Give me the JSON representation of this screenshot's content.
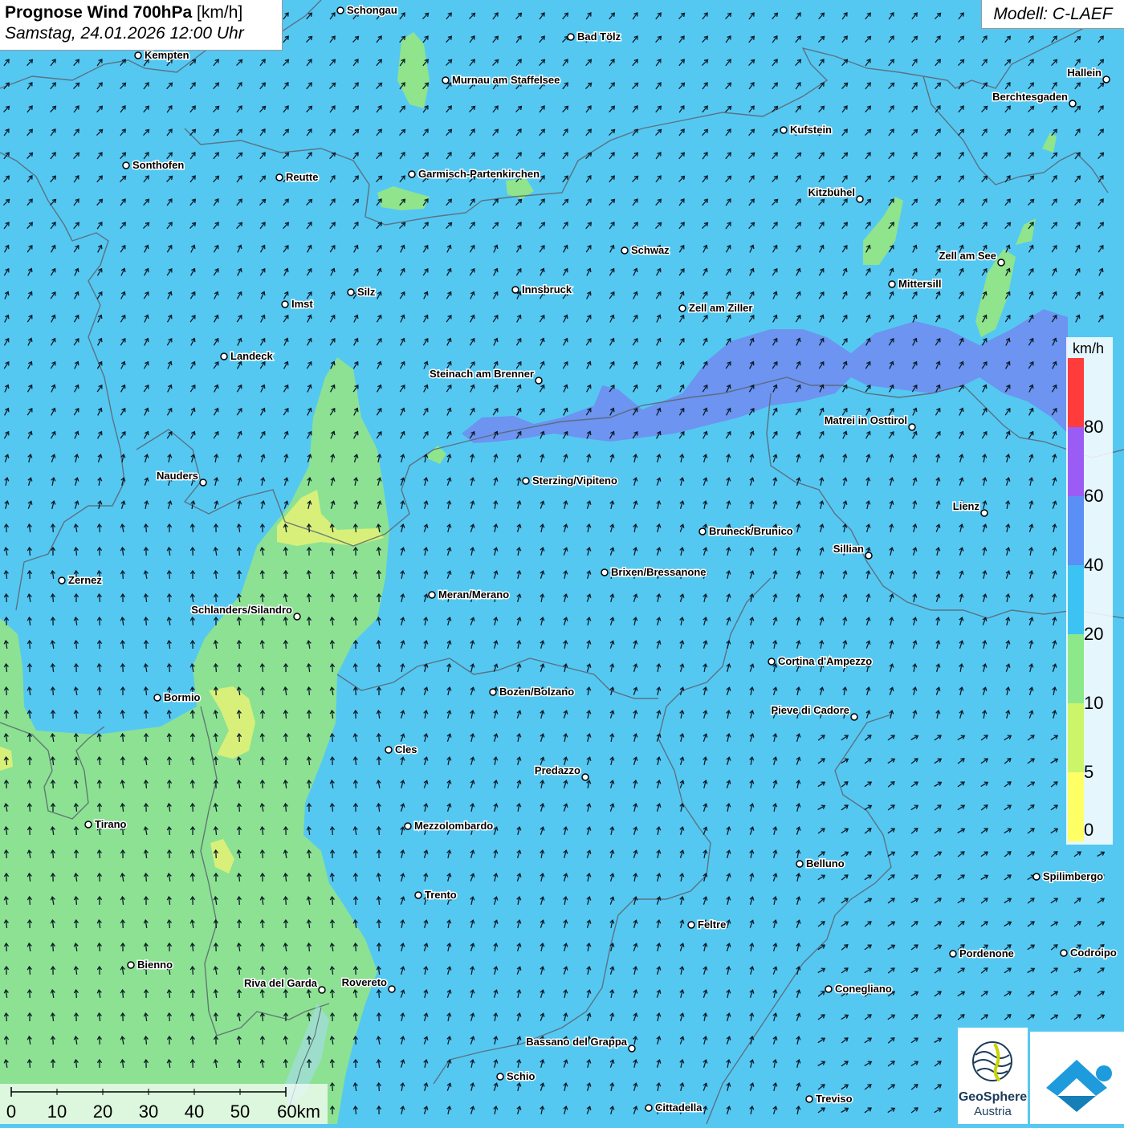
{
  "header": {
    "title_bold": "Prognose Wind 700hPa",
    "title_unit": "[km/h]",
    "date": "Samstag, 24.01.2026 12:00 Uhr",
    "model": "Modell: C-LAEF"
  },
  "legend": {
    "unit": "km/h",
    "ticks": [
      "80",
      "60",
      "40",
      "20",
      "10",
      "5",
      "0"
    ],
    "colors": [
      "#ff3b3b",
      "#9b5cf5",
      "#5a8ff5",
      "#3cc3f3",
      "#8de88a",
      "#cdf56a",
      "#ffff66"
    ]
  },
  "scale": {
    "labels": [
      "0",
      "10",
      "20",
      "30",
      "40",
      "50",
      "60km"
    ]
  },
  "logos": {
    "geosphere_line1": "GeoSphere",
    "geosphere_line2": "Austria"
  },
  "colors": {
    "wind_lt10": "#8fe48c",
    "wind_10_20": "#55c8f2",
    "wind_20_40": "#6f8ef0"
  },
  "cities": [
    {
      "name": "Schongau"
    },
    {
      "name": "Bad Tölz"
    },
    {
      "name": "Kempten"
    },
    {
      "name": "Murnau am Staffelsee"
    },
    {
      "name": "Hallein"
    },
    {
      "name": "Berchtesgaden"
    },
    {
      "name": "Kufstein"
    },
    {
      "name": "Sonthofen"
    },
    {
      "name": "Reutte"
    },
    {
      "name": "Garmisch-Partenkirchen"
    },
    {
      "name": "Kitzbühel"
    },
    {
      "name": "Schwaz"
    },
    {
      "name": "Zell am See"
    },
    {
      "name": "Mittersill"
    },
    {
      "name": "Innsbruck"
    },
    {
      "name": "Silz"
    },
    {
      "name": "Imst"
    },
    {
      "name": "Zell am Ziller"
    },
    {
      "name": "Landeck"
    },
    {
      "name": "Steinach am Brenner"
    },
    {
      "name": "Matrei in Osttirol"
    },
    {
      "name": "Nauders"
    },
    {
      "name": "Sterzing/Vipiteno"
    },
    {
      "name": "Lienz"
    },
    {
      "name": "Bruneck/Brunico"
    },
    {
      "name": "Sillian"
    },
    {
      "name": "Brixen/Bressanone"
    },
    {
      "name": "Zernez"
    },
    {
      "name": "Meran/Merano"
    },
    {
      "name": "Schlanders/Silandro"
    },
    {
      "name": "Cortina d'Ampezzo"
    },
    {
      "name": "Bozen/Bolzano"
    },
    {
      "name": "Bormio"
    },
    {
      "name": "Pieve di Cadore"
    },
    {
      "name": "Cles"
    },
    {
      "name": "Predazzo"
    },
    {
      "name": "Tirano"
    },
    {
      "name": "Mezzolombardo"
    },
    {
      "name": "Belluno"
    },
    {
      "name": "Spilimbergo"
    },
    {
      "name": "Trento"
    },
    {
      "name": "Feltre"
    },
    {
      "name": "Bienno"
    },
    {
      "name": "Pordenone"
    },
    {
      "name": "Codroipo"
    },
    {
      "name": "Riva del Garda"
    },
    {
      "name": "Rovereto"
    },
    {
      "name": "Conegliano"
    },
    {
      "name": "Bassano del Grappa"
    },
    {
      "name": "Schio"
    },
    {
      "name": "Treviso"
    },
    {
      "name": "Cittadella"
    }
  ]
}
